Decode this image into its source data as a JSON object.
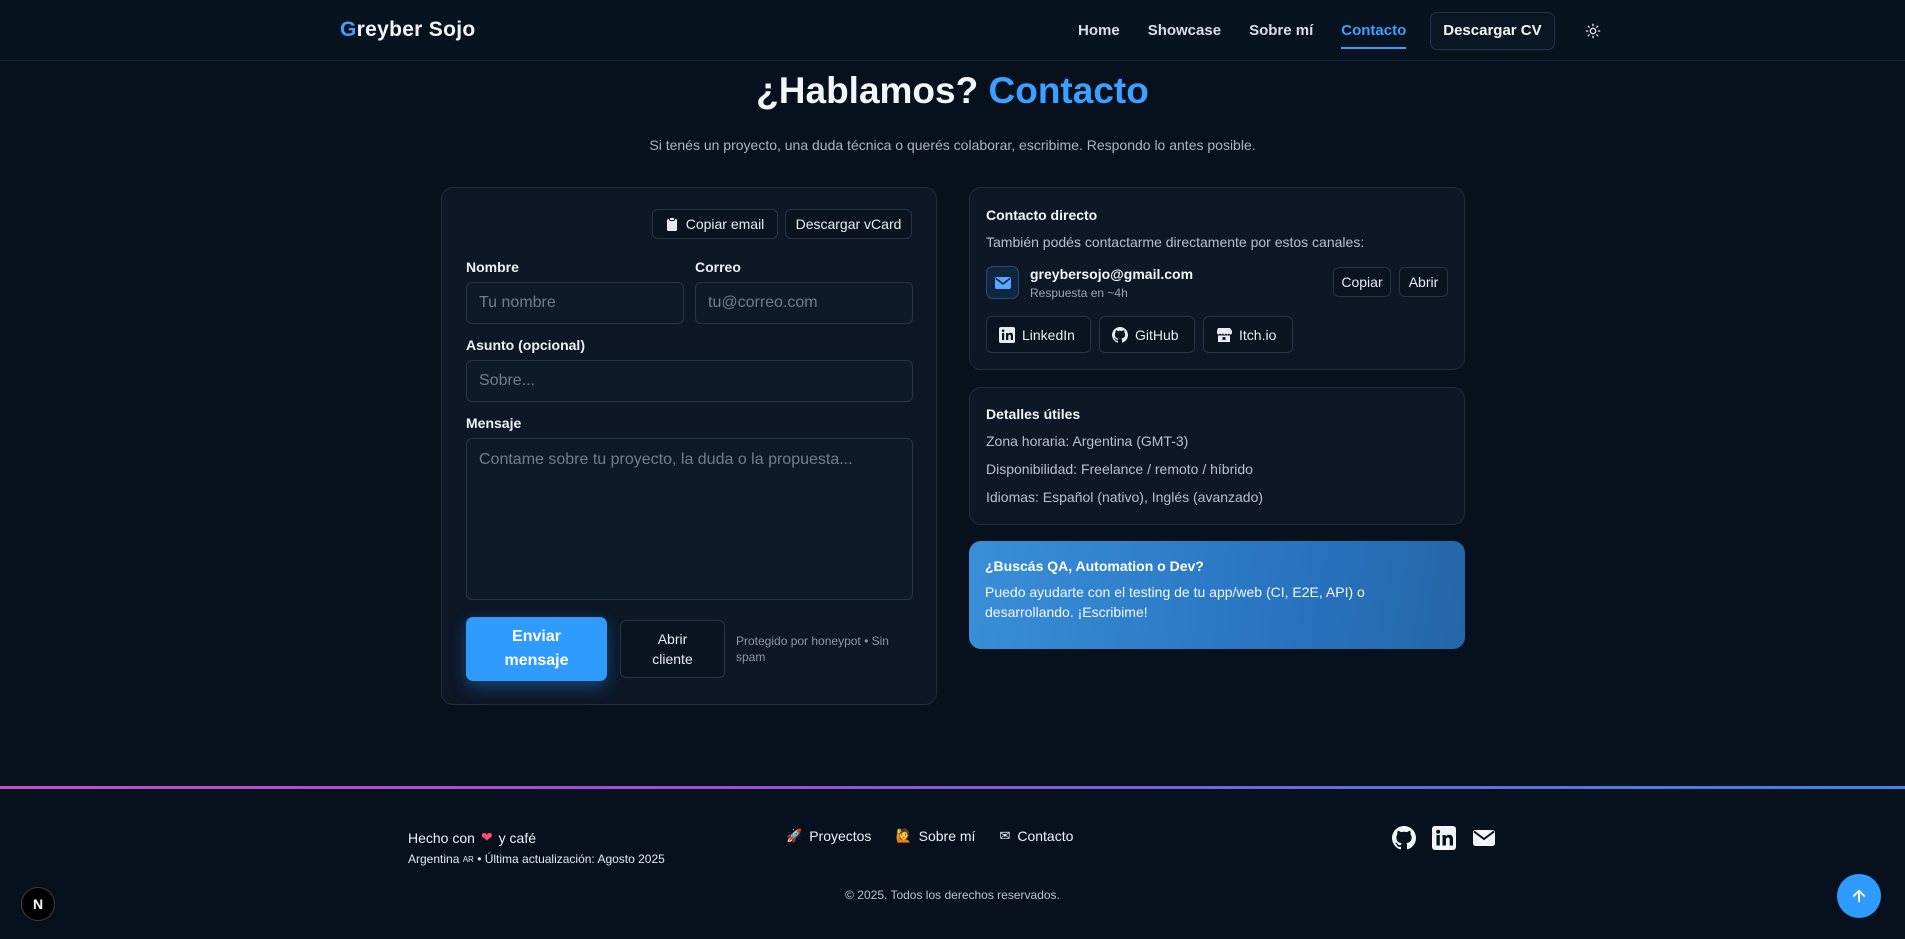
{
  "header": {
    "brand_first": "G",
    "brand_rest": "reyber Sojo",
    "nav": [
      {
        "label": "Home"
      },
      {
        "label": "Showcase"
      },
      {
        "label": "Sobre mí"
      },
      {
        "label": "Contacto",
        "active": true
      }
    ],
    "cv_button": "Descargar CV",
    "theme_icon": "sun-icon"
  },
  "hero": {
    "title": "¿Hablamos?",
    "title_accent": "Contacto",
    "subtitle": "Si tenés un proyecto, una duda técnica o querés colaborar, escribime. Respondo lo antes posible."
  },
  "form": {
    "copy_email": "Copiar email",
    "download_vcard": "Descargar vCard",
    "name_label": "Nombre",
    "name_placeholder": "Tu nombre",
    "email_label": "Correo",
    "email_placeholder": "tu@correo.com",
    "subject_label": "Asunto (opcional)",
    "subject_placeholder": "Sobre...",
    "message_label": "Mensaje",
    "message_placeholder": "Contame sobre tu proyecto, la duda o la propuesta...",
    "send_line1": "Enviar",
    "send_line2": "mensaje",
    "client_line1": "Abrir",
    "client_line2": "cliente",
    "honeypot_note": "Protegido por honeypot • Sin spam"
  },
  "direct": {
    "title": "Contacto directo",
    "text": "También podés contactarme directamente por estos canales:",
    "email": "greybersojo@gmail.com",
    "response_time": "Respuesta en ~4h",
    "copy": "Copiar",
    "open": "Abrir",
    "socials": [
      {
        "label": "LinkedIn",
        "icon": "linkedin-icon"
      },
      {
        "label": "GitHub",
        "icon": "github-icon"
      },
      {
        "label": "Itch.io",
        "icon": "itchio-icon"
      }
    ]
  },
  "details": {
    "title": "Detalles útiles",
    "items": [
      "Zona horaria: Argentina (GMT-3)",
      "Disponibilidad: Freelance / remoto / híbrido",
      "Idiomas: Español (nativo), Inglés (avanzado)"
    ]
  },
  "promo": {
    "title": "¿Buscás QA, Automation o Dev?",
    "text": "Puedo ayudarte con el testing de tu app/web (CI, E2E, API) o desarrollando. ¡Escribime!"
  },
  "footer": {
    "made_prefix": "Hecho con",
    "made_suffix": "y café",
    "country": "Argentina",
    "country_code": "AR",
    "updated": "• Última actualización: Agosto 2025",
    "links": [
      {
        "emoji": "🚀",
        "label": "Proyectos"
      },
      {
        "emoji": "🙋",
        "label": "Sobre mí"
      },
      {
        "emoji": "✉",
        "label": "Contacto"
      }
    ],
    "copyright": "© 2025. Todos los derechos reservados."
  },
  "badge": "N",
  "colors": {
    "accent": "#3ba0ff",
    "background": "#07111e",
    "card": "#0d1726"
  }
}
